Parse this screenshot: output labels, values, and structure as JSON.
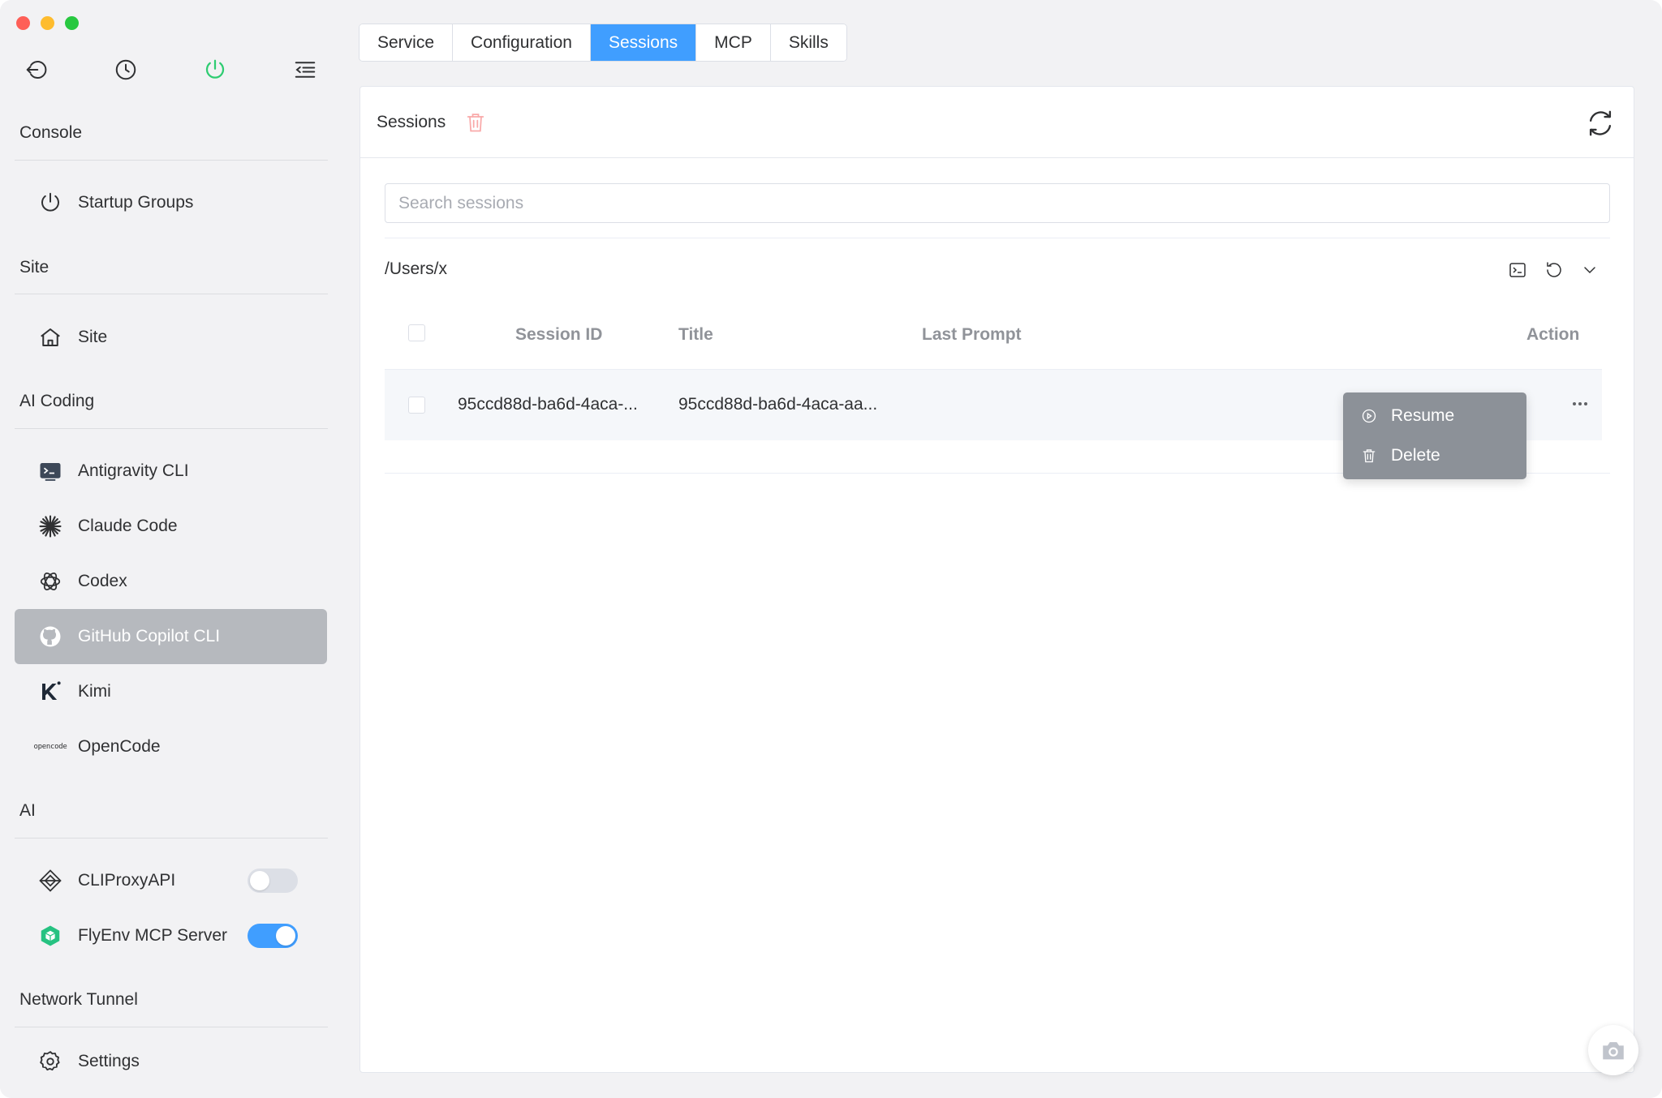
{
  "sidebar": {
    "sections": {
      "console": "Console",
      "site": "Site",
      "ai_coding": "AI Coding",
      "ai": "AI",
      "network_tunnel": "Network Tunnel"
    },
    "items": {
      "startup_groups": "Startup Groups",
      "site": "Site",
      "antigravity": "Antigravity CLI",
      "claude": "Claude Code",
      "codex": "Codex",
      "copilot": "GitHub Copilot CLI",
      "kimi": "Kimi",
      "opencode": "OpenCode",
      "opencode_logo_text": "opencode",
      "cliproxy": "CLIProxyAPI",
      "flyenv_mcp": "FlyEnv MCP Server",
      "settings": "Settings"
    },
    "toggles": {
      "cliproxy": false,
      "flyenv_mcp": true
    }
  },
  "tabs": [
    "Service",
    "Configuration",
    "Sessions",
    "MCP",
    "Skills"
  ],
  "active_tab": "Sessions",
  "card": {
    "title": "Sessions",
    "search_placeholder": "Search sessions",
    "path": "/Users/x"
  },
  "table": {
    "headers": {
      "session_id": "Session ID",
      "title": "Title",
      "last_prompt": "Last Prompt",
      "action": "Action"
    },
    "rows": [
      {
        "session_id": "95ccd88d-ba6d-4aca-...",
        "title": "95ccd88d-ba6d-4aca-aa...",
        "last_prompt": ""
      }
    ]
  },
  "dropdown": {
    "resume": "Resume",
    "delete": "Delete"
  },
  "colors": {
    "accent": "#409eff",
    "active_nav": "#b6b9be",
    "power_green": "#2ecc71",
    "trash_red": "#f56c6c"
  }
}
